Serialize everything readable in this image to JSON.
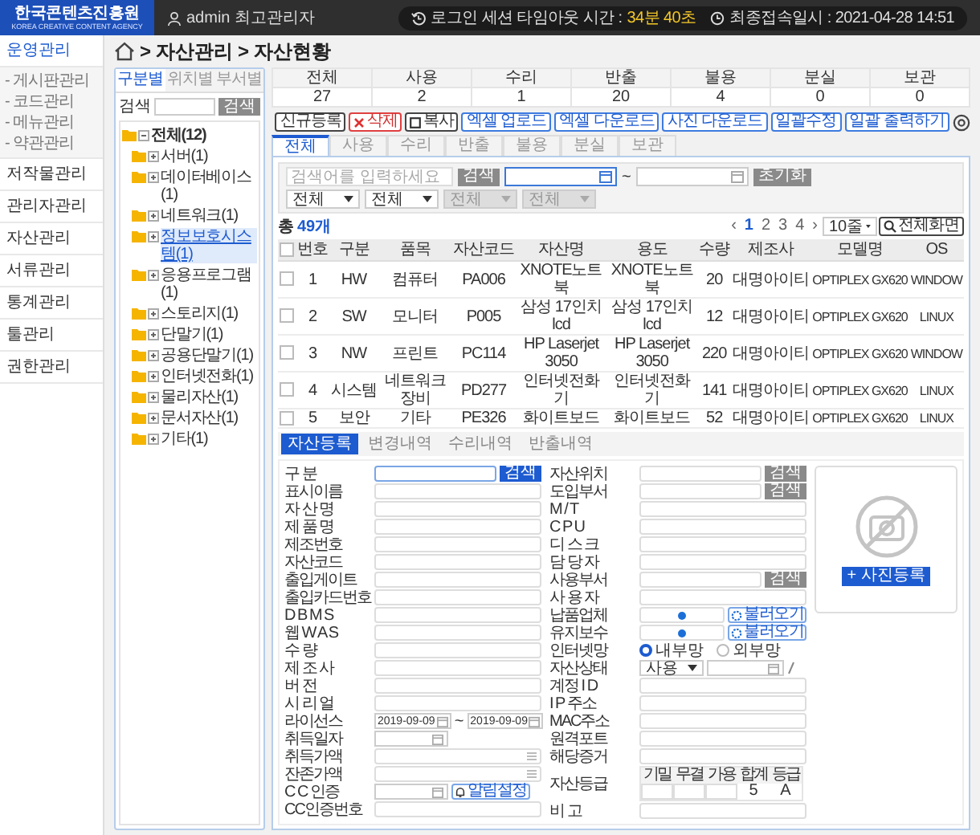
{
  "header": {
    "logo_title": "한국콘텐츠진흥원",
    "logo_subtitle": "KOREA CREATIVE CONTENT AGENCY",
    "user": "admin 최고관리자",
    "session_label": "로그인 세션 타임아웃 시간 :",
    "session_value": "34분 40초",
    "last_login": "최종접속일시 : 2021-04-28 14:51"
  },
  "sidebar": {
    "items": [
      {
        "label": "운영관리",
        "selected": true,
        "children": [
          {
            "label": "- 게시판관리"
          },
          {
            "label": "- 코드관리"
          },
          {
            "label": "- 메뉴관리"
          },
          {
            "label": "- 약관관리"
          }
        ]
      },
      {
        "label": "저작물관리",
        "selected": false
      },
      {
        "label": "관리자관리",
        "selected": false
      },
      {
        "label": "자산관리",
        "selected": false
      },
      {
        "label": "서류관리",
        "selected": false
      },
      {
        "label": "통계관리",
        "selected": false
      },
      {
        "label": "툴관리",
        "selected": false
      },
      {
        "label": "권한관리",
        "selected": false
      }
    ]
  },
  "breadcrumb": {
    "separator": ">",
    "items": [
      "자산관리",
      "자산현황"
    ]
  },
  "tree_panel": {
    "tabs": [
      {
        "label": "구분별",
        "selected": true
      },
      {
        "label": "위치별",
        "selected": false
      },
      {
        "label": "부서별",
        "selected": false
      }
    ],
    "search_label": "검색",
    "search_button": "검색",
    "tree": {
      "label": "전체(12)",
      "expanded": true,
      "selected": false,
      "children": [
        {
          "label": "서버(1)",
          "expanded": false,
          "selected": false
        },
        {
          "label": "데이터베이스(1)",
          "expanded": false,
          "selected": false
        },
        {
          "label": "네트워크(1)",
          "expanded": false,
          "selected": false
        },
        {
          "label": "정보보호시스템(1)",
          "expanded": false,
          "selected": true
        },
        {
          "label": "응용프로그램(1)",
          "expanded": false,
          "selected": false
        },
        {
          "label": "스토리지(1)",
          "expanded": false,
          "selected": false
        },
        {
          "label": "단말기(1)",
          "expanded": false,
          "selected": false
        },
        {
          "label": "공용단말기(1)",
          "expanded": false,
          "selected": false
        },
        {
          "label": "인터넷전화(1)",
          "expanded": false,
          "selected": false
        },
        {
          "label": "물리자산(1)",
          "expanded": false,
          "selected": false
        },
        {
          "label": "문서자산(1)",
          "expanded": false,
          "selected": false
        },
        {
          "label": "기타(1)",
          "expanded": false,
          "selected": false
        }
      ]
    }
  },
  "summary": {
    "columns": [
      "전체",
      "사용",
      "수리",
      "반출",
      "불용",
      "분실",
      "보관"
    ],
    "values": [
      "27",
      "2",
      "1",
      "20",
      "4",
      "0",
      "0"
    ]
  },
  "status_tabs": [
    {
      "label": "전체",
      "selected": true
    },
    {
      "label": "사용",
      "selected": false
    },
    {
      "label": "수리",
      "selected": false
    },
    {
      "label": "반출",
      "selected": false
    },
    {
      "label": "불용",
      "selected": false
    },
    {
      "label": "분실",
      "selected": false
    },
    {
      "label": "보관",
      "selected": false
    }
  ],
  "toolbar": [
    {
      "label": "신규등록",
      "kind": "outline"
    },
    {
      "label": "삭제",
      "kind": "delete"
    },
    {
      "label": "복사",
      "kind": "copy"
    },
    {
      "label": "엑셀 업로드",
      "kind": "blue"
    },
    {
      "label": "엑셀 다운로드",
      "kind": "blue"
    },
    {
      "label": "사진 다운로드",
      "kind": "blue"
    },
    {
      "label": "일괄수정",
      "kind": "blue"
    },
    {
      "label": "일괄 출력하기",
      "kind": "blue"
    }
  ],
  "filter": {
    "search": {
      "placeholder": "검색어를 입력하세요"
    },
    "search_button": "검색",
    "date_from": {
      "focused": true
    },
    "range_separator": "~",
    "date_to": {
      "focused": false
    },
    "reset_button": "초기화",
    "selects": [
      {
        "value": "전체",
        "disabled": false
      },
      {
        "value": "전체",
        "disabled": false
      },
      {
        "value": "전체",
        "disabled": true
      },
      {
        "value": "전체",
        "disabled": true
      }
    ]
  },
  "list_header": {
    "count_label": "총",
    "count_value": "49개",
    "pagination": {
      "prev": "‹",
      "pages": [
        {
          "label": "1",
          "selected": true
        },
        {
          "label": "2",
          "selected": false
        },
        {
          "label": "3",
          "selected": false
        },
        {
          "label": "4",
          "selected": false
        }
      ],
      "next": "›"
    },
    "page_size": "10줄",
    "fullscreen_button": "전체화면"
  },
  "table": {
    "select_all": {
      "checked": false
    },
    "columns": [
      "번호",
      "구분",
      "품목",
      "자산코드",
      "자산명",
      "용도",
      "수량",
      "제조사",
      "모델명",
      "OS"
    ],
    "rows": [
      {
        "checked": false,
        "cells": [
          "1",
          "HW",
          "컴퓨터",
          "PA006",
          "XNOTE노트북",
          "XNOTE노트북",
          "20",
          "대명아이티",
          "OPTIPLEX GX620",
          "WINDOW"
        ]
      },
      {
        "checked": false,
        "cells": [
          "2",
          "SW",
          "모니터",
          "P005",
          "삼성 17인치 lcd",
          "삼성 17인치 lcd",
          "12",
          "대명아이티",
          "OPTIPLEX GX620",
          "LINUX"
        ]
      },
      {
        "checked": false,
        "cells": [
          "3",
          "NW",
          "프린트",
          "PC114",
          "HP Laserjet 3050",
          "HP Laserjet 3050",
          "220",
          "대명아이티",
          "OPTIPLEX GX620",
          "WINDOW"
        ]
      },
      {
        "checked": false,
        "cells": [
          "4",
          "시스템",
          "네트워크 장비",
          "PD277",
          "인터넷전화기",
          "인터넷전화기",
          "141",
          "대명아이티",
          "OPTIPLEX GX620",
          "LINUX"
        ]
      },
      {
        "checked": false,
        "cells": [
          "5",
          "보안",
          "기타",
          "PE326",
          "화이트보드",
          "화이트보드",
          "52",
          "대명아이티",
          "OPTIPLEX GX620",
          "LINUX"
        ]
      }
    ]
  },
  "detail_tabs": [
    {
      "label": "자산등록",
      "selected": true
    },
    {
      "label": "변경내역",
      "selected": false
    },
    {
      "label": "수리내역",
      "selected": false
    },
    {
      "label": "반출내역",
      "selected": false
    }
  ],
  "form": {
    "left": [
      {
        "label": "구 분",
        "kind": "search-primary",
        "button": "검색"
      },
      {
        "label": "표시이름",
        "kind": "text"
      },
      {
        "label": "자 산 명",
        "kind": "text"
      },
      {
        "label": "제 품 명",
        "kind": "text"
      },
      {
        "label": "제조번호",
        "kind": "text"
      },
      {
        "label": "자산코드",
        "kind": "text"
      },
      {
        "label": "출입게이트",
        "kind": "text"
      },
      {
        "label": "출입카드번호",
        "kind": "text"
      },
      {
        "label": "D B M S",
        "kind": "text"
      },
      {
        "label": "웹 W A S",
        "kind": "text"
      },
      {
        "label": "수 량",
        "kind": "text"
      },
      {
        "label": "제 조 사",
        "kind": "text"
      },
      {
        "label": "버 전",
        "kind": "text"
      },
      {
        "label": "시 리 얼",
        "kind": "text"
      },
      {
        "label": "라이선스",
        "kind": "date-range",
        "from": "2019-09-09",
        "separator": "~",
        "to": "2019-09-09"
      },
      {
        "label": "취득일자",
        "kind": "date"
      },
      {
        "label": "취득가액",
        "kind": "amount"
      },
      {
        "label": "잔존가액",
        "kind": "amount"
      },
      {
        "label": "C C 인증",
        "kind": "date-alert",
        "button": "알림설정"
      },
      {
        "label": "CC인증번호",
        "kind": "text"
      }
    ],
    "right": [
      {
        "label": "자산위치",
        "kind": "search",
        "button": "검색"
      },
      {
        "label": "도입부서",
        "kind": "search",
        "button": "검색"
      },
      {
        "label": "M / T",
        "kind": "text"
      },
      {
        "label": "C P U",
        "kind": "text"
      },
      {
        "label": "디 스 크",
        "kind": "text"
      },
      {
        "label": "담 당 자",
        "kind": "text"
      },
      {
        "label": "사용부서",
        "kind": "search",
        "button": "검색"
      },
      {
        "label": "사 용 자",
        "kind": "text"
      },
      {
        "label": "납품업체",
        "kind": "lookup",
        "button": "불러오기"
      },
      {
        "label": "유지보수",
        "kind": "lookup",
        "button": "불러오기"
      },
      {
        "label": "인터넷망",
        "kind": "radio",
        "options": [
          {
            "label": "내부망",
            "selected": true
          },
          {
            "label": "외부망",
            "selected": false
          }
        ]
      },
      {
        "label": "자산상태",
        "kind": "status",
        "value": "사용"
      },
      {
        "label": "계정 I D",
        "kind": "text"
      },
      {
        "label": "I P 주소",
        "kind": "text"
      },
      {
        "label": "MAC주소",
        "kind": "text"
      },
      {
        "label": "원격포트",
        "kind": "text"
      },
      {
        "label": "해당증거",
        "kind": "text"
      },
      {
        "label": "자산등급",
        "kind": "grade",
        "headers": [
          "기밀",
          "무결",
          "가용",
          "합계",
          "등급"
        ],
        "values": [
          {
            "kind": "input"
          },
          {
            "kind": "input"
          },
          {
            "kind": "input"
          },
          {
            "kind": "text",
            "text": "5"
          },
          {
            "kind": "text",
            "text": "A"
          }
        ]
      },
      {
        "label": "비 고",
        "kind": "text"
      }
    ]
  },
  "photo": {
    "button": "+ 사진등록"
  }
}
